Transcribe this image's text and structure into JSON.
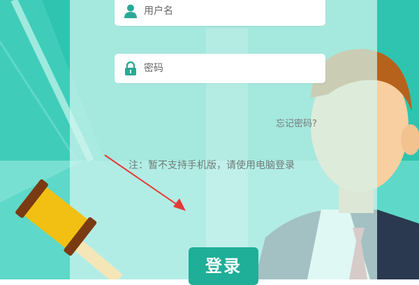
{
  "login_form": {
    "username_placeholder": "用户名",
    "password_placeholder": "密码",
    "forgot_password": "忘记密码?",
    "notice": "注：暂不支持手机版，请使用电脑登录",
    "submit_label": "登录"
  },
  "colors": {
    "background_teal": "#2ec4b0",
    "button_green": "#1fae97",
    "icon_teal": "#2aa996",
    "arrow_red": "#e53935",
    "gavel_yellow": "#f2c012"
  },
  "icons": [
    "user-icon",
    "lock-icon",
    "gavel-illustration",
    "businessman-illustration",
    "arrow-indicator"
  ]
}
